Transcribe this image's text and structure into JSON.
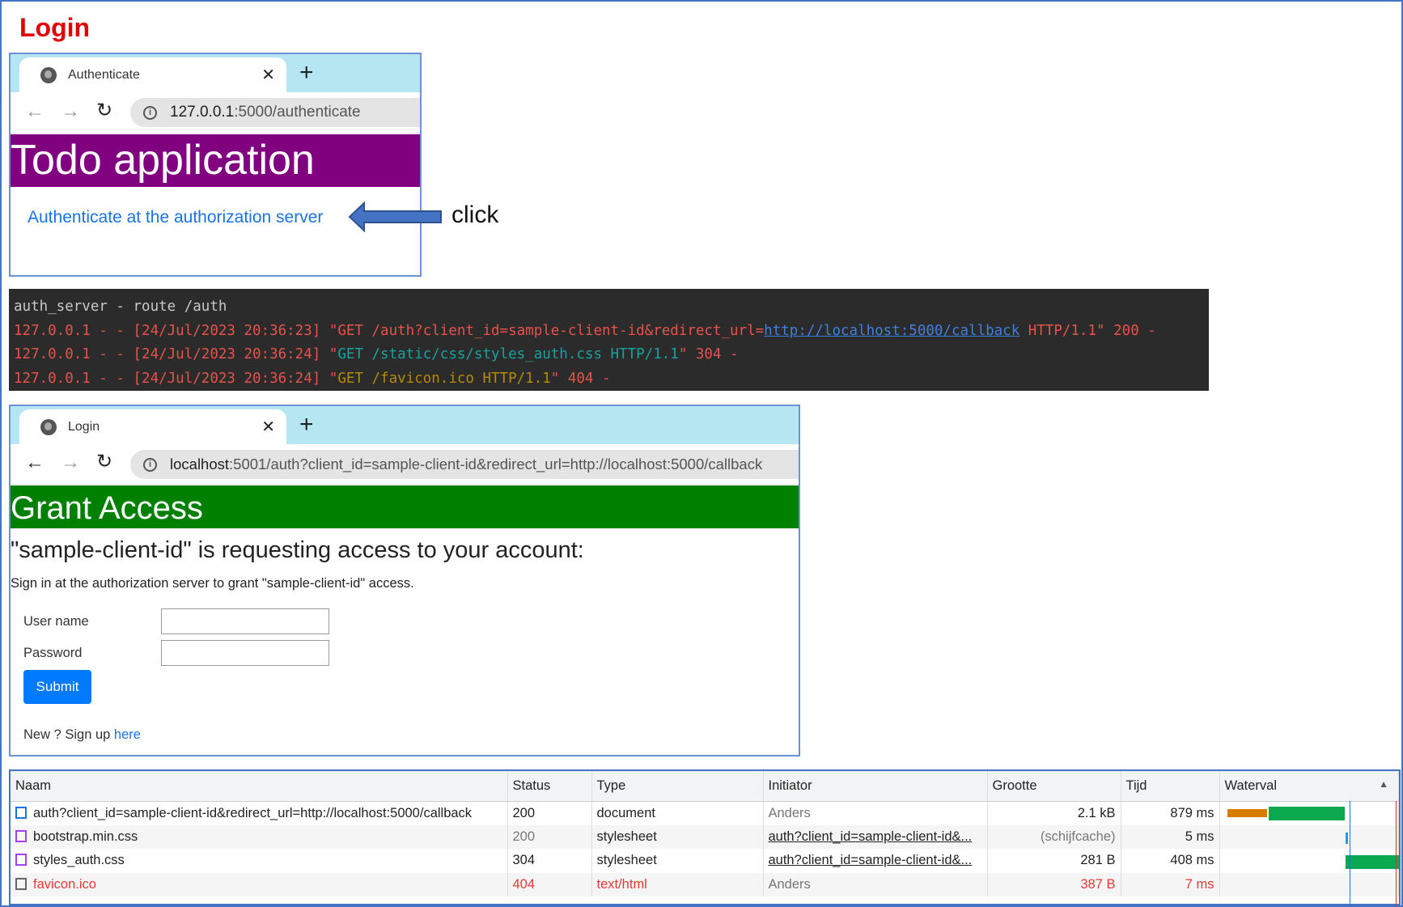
{
  "heading": "Login",
  "annotation": {
    "label": "click"
  },
  "browser1": {
    "tab_title": "Authenticate",
    "url_host": "127.0.0.1",
    "url_rest": ":5000/authenticate",
    "page_title": "Todo application",
    "header_color": "#800080",
    "link": "Authenticate at the authorization server"
  },
  "terminal": {
    "title": "auth_server - route /auth",
    "lines": [
      {
        "prefix": "127.0.0.1 - - [24/Jul/2023 20:36:23] \"GET /auth?client_id=sample-client-id&redirect_url=",
        "link": "http://localhost:5000/callback",
        "suffix": " HTTP/1.1\" 200 -"
      },
      {
        "prefix": "127.0.0.1 - - [24/Jul/2023 20:36:24] \"",
        "request": "GET /static/css/styles_auth.css HTTP/1.1",
        "suffix": "\" 304 -"
      },
      {
        "prefix": "127.0.0.1 - - [24/Jul/2023 20:36:24] \"",
        "request": "GET /favicon.ico HTTP/1.1",
        "suffix": "\" 404 -"
      }
    ]
  },
  "browser2": {
    "tab_title": "Login",
    "url_host": "localhost",
    "url_rest": ":5001/auth?client_id=sample-client-id&redirect_url=http://localhost:5000/callback",
    "page_title": "Grant Access",
    "header_color": "#008000",
    "subtitle": "\"sample-client-id\" is requesting access to your account:",
    "description": "Sign in at the authorization server to grant \"sample-client-id\" access.",
    "username_label": "User name",
    "username_value": "",
    "password_label": "Password",
    "password_value": "",
    "submit": "Submit",
    "signup_text": "New ? Sign up ",
    "signup_link": "here"
  },
  "network": {
    "columns": [
      "Naam",
      "Status",
      "Type",
      "Initiator",
      "Grootte",
      "Tijd",
      "Waterval"
    ],
    "rows": [
      {
        "name": "auth?client_id=sample-client-id&redirect_url=http://localhost:5000/callback",
        "status": "200",
        "type": "document",
        "initiator": "Anders",
        "size": "2.1 kB",
        "time": "879 ms",
        "icon": "document-icon"
      },
      {
        "name": "bootstrap.min.css",
        "status": "200",
        "type": "stylesheet",
        "initiator": "auth?client_id=sample-client-id&...",
        "size": "(schijfcache)",
        "time": "5 ms",
        "icon": "stylesheet-icon"
      },
      {
        "name": "styles_auth.css",
        "status": "304",
        "type": "stylesheet",
        "initiator": "auth?client_id=sample-client-id&...",
        "size": "281 B",
        "time": "408 ms",
        "icon": "stylesheet-icon"
      },
      {
        "name": "favicon.ico",
        "status": "404",
        "type": "text/html",
        "initiator": "Anders",
        "size": "387 B",
        "time": "7 ms",
        "icon": "file-icon"
      }
    ]
  }
}
